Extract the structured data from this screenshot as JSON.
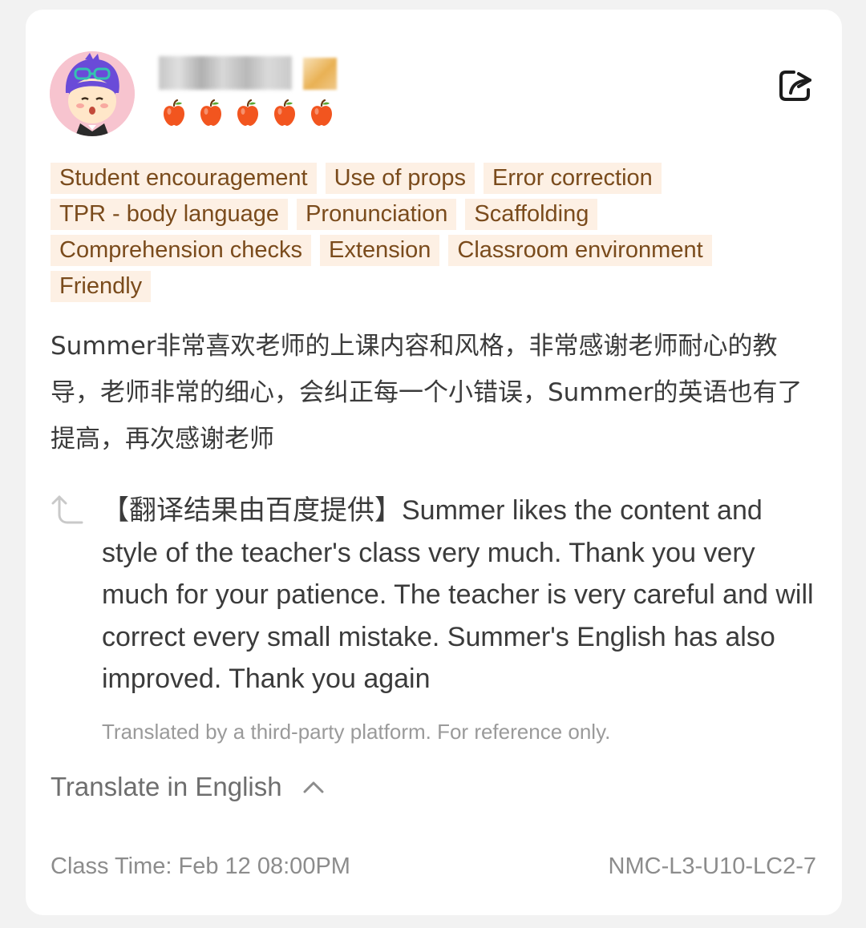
{
  "review": {
    "rating": 5,
    "rating_max": 5,
    "tags": [
      "Student encouragement",
      "Use of props",
      "Error correction",
      "TPR - body language",
      "Pronunciation",
      "Scaffolding",
      "Comprehension checks",
      "Extension",
      "Classroom environment",
      "Friendly"
    ],
    "comment": "Summer非常喜欢老师的上课内容和风格，非常感谢老师耐心的教导，老师非常的细心，会纠正每一个小错误，Summer的英语也有了提高，再次感谢老师",
    "translation": "【翻译结果由百度提供】Summer likes the content and style of the teacher's class very much. Thank you very much for your patience. The teacher is very careful and will correct every small mistake. Summer's English has also improved. Thank you again",
    "disclaimer": "Translated by a third-party platform. For reference only.",
    "translate_toggle_label": "Translate in English",
    "class_time": "Class Time: Feb 12 08:00PM",
    "lesson_code": "NMC-L3-U10-LC2-7"
  },
  "colors": {
    "tag_bg": "#fdf0e4",
    "tag_text": "#7a4b1c",
    "rating_apple": "#f2551f",
    "avatar_bg": "#f7c4cf"
  },
  "icons": {
    "share": "share-icon",
    "rating": "apple-icon",
    "translation": "translate-return-icon",
    "toggle": "chevron-up-icon"
  }
}
